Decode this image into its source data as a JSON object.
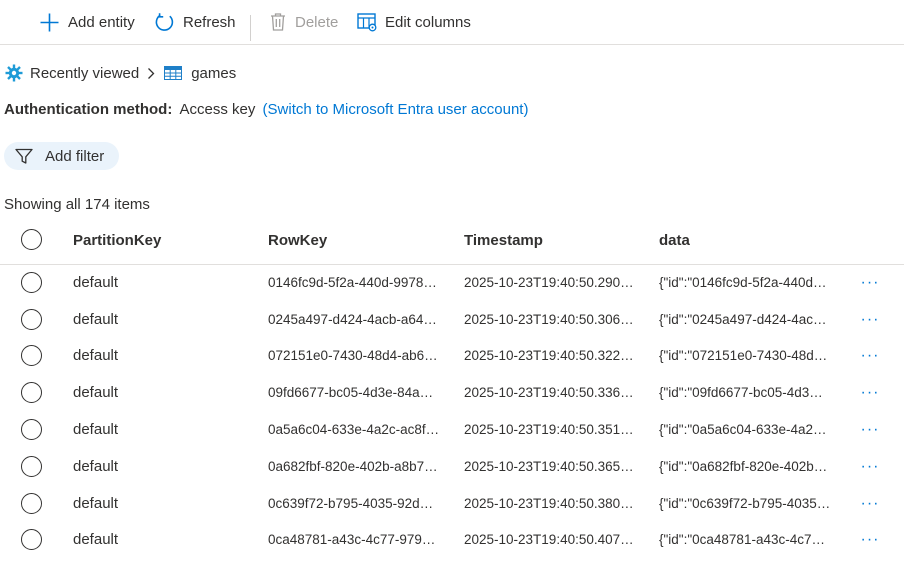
{
  "toolbar": {
    "add_entity": "Add entity",
    "refresh": "Refresh",
    "delete": "Delete",
    "edit_columns": "Edit columns"
  },
  "breadcrumb": {
    "root": "Recently viewed",
    "current": "games"
  },
  "auth": {
    "label": "Authentication method:",
    "value": "Access key",
    "switch_link": "(Switch to Microsoft Entra user account)"
  },
  "filter": {
    "label": "Add filter"
  },
  "summary": {
    "count_text": "Showing all 174 items"
  },
  "table": {
    "columns": [
      "PartitionKey",
      "RowKey",
      "Timestamp",
      "data"
    ],
    "rows": [
      {
        "pk": "default",
        "rk": "0146fc9d-5f2a-440d-9978…",
        "ts": "2025-10-23T19:40:50.2909…",
        "data": "{\"id\":\"0146fc9d-5f2a-440d…"
      },
      {
        "pk": "default",
        "rk": "0245a497-d424-4acb-a64…",
        "ts": "2025-10-23T19:40:50.3068…",
        "data": "{\"id\":\"0245a497-d424-4ac…"
      },
      {
        "pk": "default",
        "rk": "072151e0-7430-48d4-ab6…",
        "ts": "2025-10-23T19:40:50.3227…",
        "data": "{\"id\":\"072151e0-7430-48d…"
      },
      {
        "pk": "default",
        "rk": "09fd6677-bc05-4d3e-84a…",
        "ts": "2025-10-23T19:40:50.3367…",
        "data": "{\"id\":\"09fd6677-bc05-4d3…"
      },
      {
        "pk": "default",
        "rk": "0a5a6c04-633e-4a2c-ac8f-…",
        "ts": "2025-10-23T19:40:50.3516…",
        "data": "{\"id\":\"0a5a6c04-633e-4a2c…"
      },
      {
        "pk": "default",
        "rk": "0a682fbf-820e-402b-a8b7…",
        "ts": "2025-10-23T19:40:50.3655…",
        "data": "{\"id\":\"0a682fbf-820e-402b…"
      },
      {
        "pk": "default",
        "rk": "0c639f72-b795-4035-92d…",
        "ts": "2025-10-23T19:40:50.3805…",
        "data": "{\"id\":\"0c639f72-b795-4035…"
      },
      {
        "pk": "default",
        "rk": "0ca48781-a43c-4c77-9791…",
        "ts": "2025-10-23T19:40:50.4074…",
        "data": "{\"id\":\"0ca48781-a43c-4c77…"
      }
    ],
    "more_glyph": "···"
  },
  "icons": {
    "add": "plus-icon",
    "refresh": "refresh-icon",
    "delete": "trash-icon",
    "edit_columns": "edit-columns-icon",
    "recent": "gear-icon",
    "table": "table-icon",
    "filter": "filter-icon"
  },
  "colors": {
    "accent": "#0078d4",
    "filter_bg": "#eaf3fb",
    "divider": "#e1dfdd",
    "disabled": "#a19f9d"
  }
}
